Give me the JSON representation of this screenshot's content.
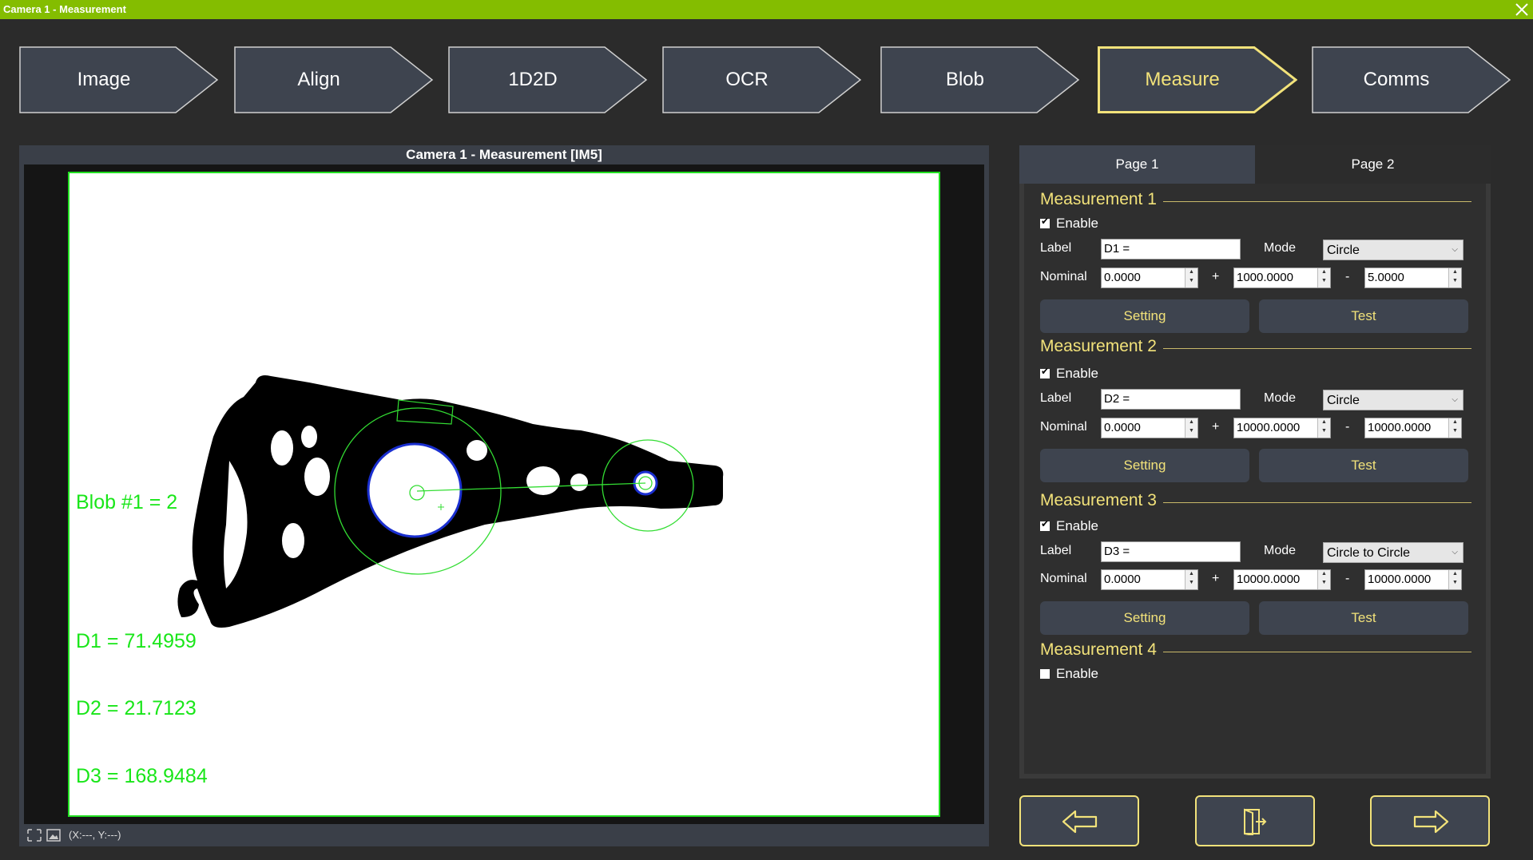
{
  "window": {
    "title": "Camera 1 - Measurement"
  },
  "steps": [
    {
      "label": "Image",
      "active": false
    },
    {
      "label": "Align",
      "active": false
    },
    {
      "label": "1D2D",
      "active": false
    },
    {
      "label": "OCR",
      "active": false
    },
    {
      "label": "Blob",
      "active": false
    },
    {
      "label": "Measure",
      "active": true
    },
    {
      "label": "Comms",
      "active": false
    }
  ],
  "camera": {
    "header": "Camera 1 -  Measurement  [IM5]",
    "overlay": {
      "blob": "Blob #1 = 2",
      "d1": "D1 = 71.4959",
      "d2": "D2 = 21.7123",
      "d3": "D3 = 168.9484"
    },
    "status": {
      "coords": "(X:---, Y:---)"
    }
  },
  "tabs": [
    {
      "label": "Page 1",
      "active": true
    },
    {
      "label": "Page 2",
      "active": false
    }
  ],
  "labels": {
    "enable": "Enable",
    "label": "Label",
    "mode": "Mode",
    "nominal": "Nominal",
    "plus": "+",
    "minus": "-",
    "setting": "Setting",
    "test": "Test"
  },
  "measurements": [
    {
      "title": "Measurement 1",
      "enabled": true,
      "label": "D1 =",
      "mode": "Circle",
      "nominal": "0.0000",
      "plus_tol": "1000.0000",
      "minus_tol": "5.0000"
    },
    {
      "title": "Measurement 2",
      "enabled": true,
      "label": "D2 =",
      "mode": "Circle",
      "nominal": "0.0000",
      "plus_tol": "10000.0000",
      "minus_tol": "10000.0000"
    },
    {
      "title": "Measurement 3",
      "enabled": true,
      "label": "D3 =",
      "mode": "Circle to Circle",
      "nominal": "0.0000",
      "plus_tol": "10000.0000",
      "minus_tol": "10000.0000"
    },
    {
      "title": "Measurement 4",
      "enabled": false
    }
  ],
  "icons": {
    "close": "close-icon",
    "back": "arrow-left-icon",
    "exit": "exit-door-icon",
    "next": "arrow-right-icon",
    "fit": "fit-to-window-icon",
    "image": "image-icon"
  },
  "colors": {
    "titlebar": "#84bd00",
    "accent": "#f2e27a",
    "overlay": "#19e619",
    "panel": "#3e444f"
  }
}
